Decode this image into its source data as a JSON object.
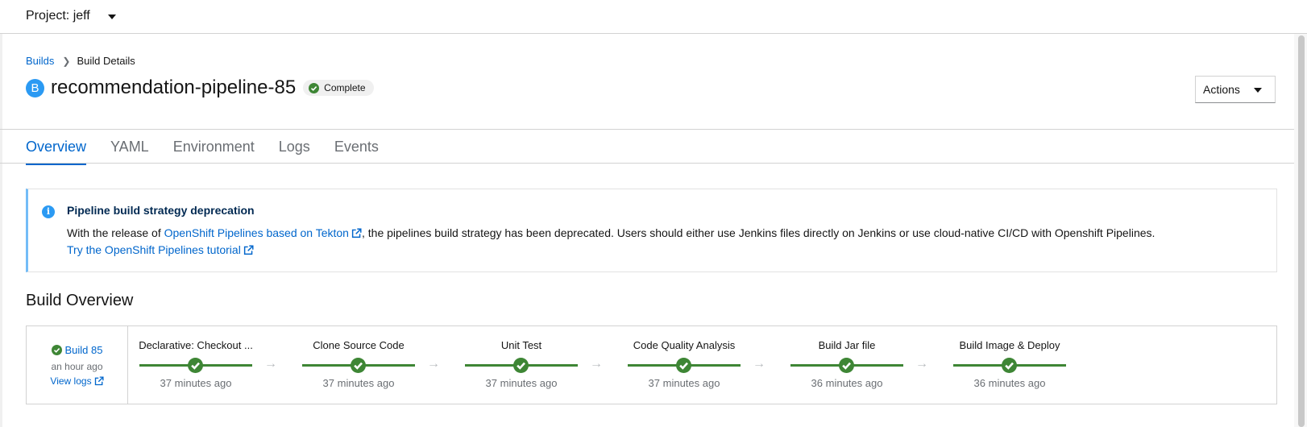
{
  "project": {
    "label": "Project: jeff"
  },
  "breadcrumb": {
    "parent": "Builds",
    "current": "Build Details"
  },
  "header": {
    "badge": "B",
    "title": "recommendation-pipeline-85",
    "status": "Complete",
    "actions_label": "Actions"
  },
  "tabs": [
    {
      "label": "Overview",
      "active": true
    },
    {
      "label": "YAML",
      "active": false
    },
    {
      "label": "Environment",
      "active": false
    },
    {
      "label": "Logs",
      "active": false
    },
    {
      "label": "Events",
      "active": false
    }
  ],
  "alert": {
    "title": "Pipeline build strategy deprecation",
    "body_prefix": "With the release of ",
    "body_link": "OpenShift Pipelines based on Tekton",
    "body_suffix": ", the pipelines build strategy has been deprecated. Users should either use Jenkins files directly on Jenkins or use cloud-native CI/CD with Openshift Pipelines.",
    "tutorial_link": "Try the OpenShift Pipelines tutorial"
  },
  "build_overview": {
    "title": "Build Overview",
    "build": {
      "name": "Build 85",
      "time": "an hour ago",
      "view_logs": "View logs"
    },
    "stages": [
      {
        "name": "Declarative: Checkout ...",
        "time": "37 minutes ago"
      },
      {
        "name": "Clone Source Code",
        "time": "37 minutes ago"
      },
      {
        "name": "Unit Test",
        "time": "37 minutes ago"
      },
      {
        "name": "Code Quality Analysis",
        "time": "37 minutes ago"
      },
      {
        "name": "Build Jar file",
        "time": "36 minutes ago"
      },
      {
        "name": "Build Image & Deploy",
        "time": "36 minutes ago"
      }
    ],
    "arrow": "→"
  },
  "colors": {
    "accent": "#0066cc",
    "success": "#3e8635",
    "info": "#2b9af3"
  }
}
